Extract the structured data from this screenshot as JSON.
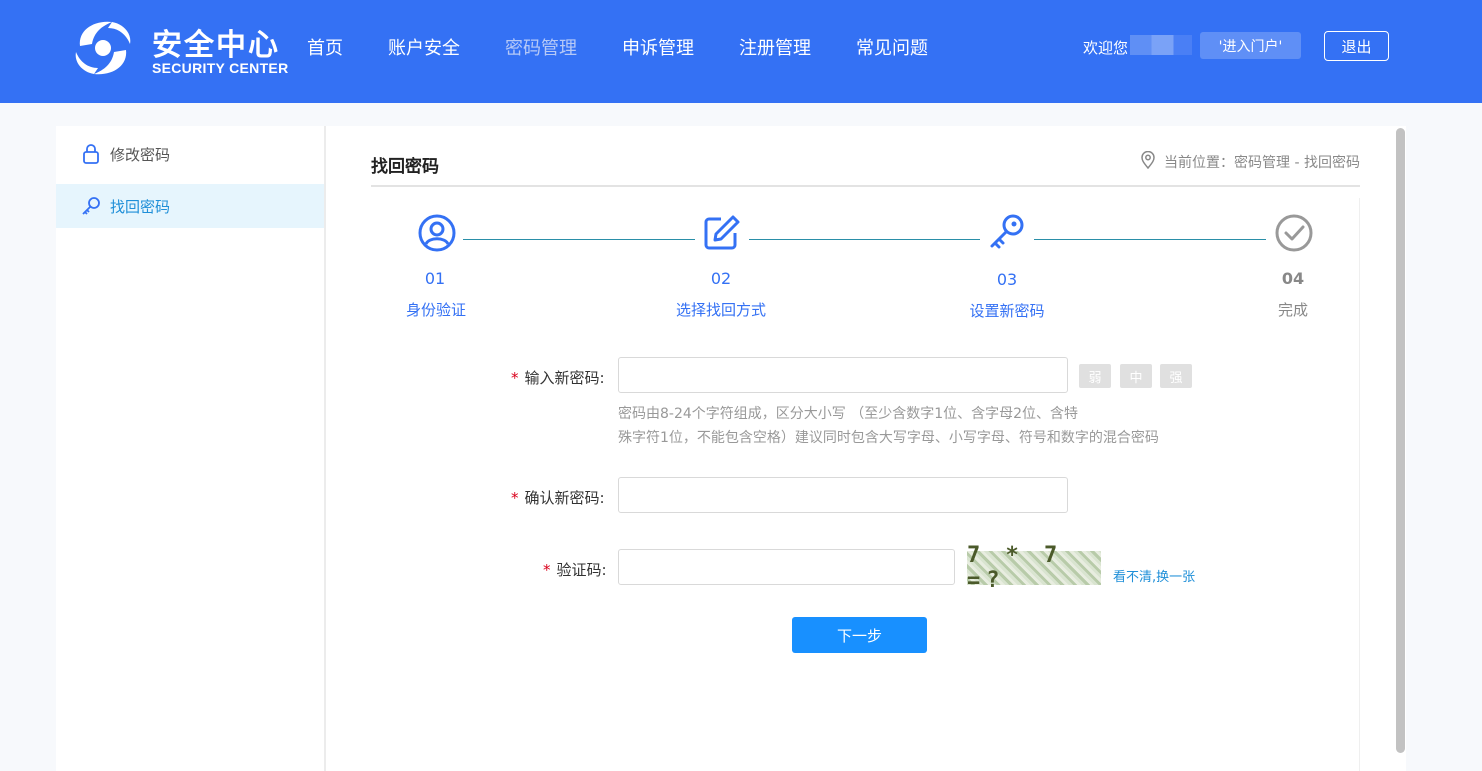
{
  "header": {
    "logo_cn": "安全中心",
    "logo_en": "SECURITY CENTER",
    "nav": [
      {
        "label": "首页",
        "active": false
      },
      {
        "label": "账户安全",
        "active": false
      },
      {
        "label": "密码管理",
        "active": true
      },
      {
        "label": "申诉管理",
        "active": false
      },
      {
        "label": "注册管理",
        "active": false
      },
      {
        "label": "常见问题",
        "active": false
      }
    ],
    "welcome": "欢迎您",
    "portal_label": "'进入门户'",
    "logout_label": "退出"
  },
  "sidebar": {
    "items": [
      {
        "label": "修改密码",
        "icon": "lock-icon",
        "active": false
      },
      {
        "label": "找回密码",
        "icon": "key-icon",
        "active": true
      }
    ]
  },
  "main": {
    "title": "找回密码",
    "location": "当前位置：密码管理 - 找回密码",
    "steps": [
      {
        "num": "01",
        "label": "身份验证",
        "icon": "user-circle-icon",
        "done": true
      },
      {
        "num": "02",
        "label": "选择找回方式",
        "icon": "edit-icon",
        "done": true
      },
      {
        "num": "03",
        "label": "设置新密码",
        "icon": "key-icon",
        "done": true
      },
      {
        "num": "04",
        "label": "完成",
        "icon": "check-circle-icon",
        "done": false
      }
    ],
    "form": {
      "new_password_label": "输入新密码:",
      "new_password_value": "",
      "strength": [
        "弱",
        "中",
        "强"
      ],
      "hint_line1": "密码由8-24个字符组成，区分大小写 （至少含数字1位、含字母2位、含特",
      "hint_line2": "殊字符1位，不能包含空格）建议同时包含大写字母、小写字母、符号和数字的混合密码",
      "confirm_label": "确认新密码:",
      "confirm_value": "",
      "captcha_label": "验证码:",
      "captcha_value": "",
      "captcha_text": "7 * 7 =?",
      "refresh_label": "看不清,换一张",
      "required_mark": "*",
      "next_label": "下一步"
    }
  },
  "colors": {
    "header_bg": "#3471f4",
    "accent": "#1890ff",
    "step_color": "#3471f4",
    "step_line": "#2a8fa8",
    "sidebar_active_bg": "#e6f5fd"
  }
}
